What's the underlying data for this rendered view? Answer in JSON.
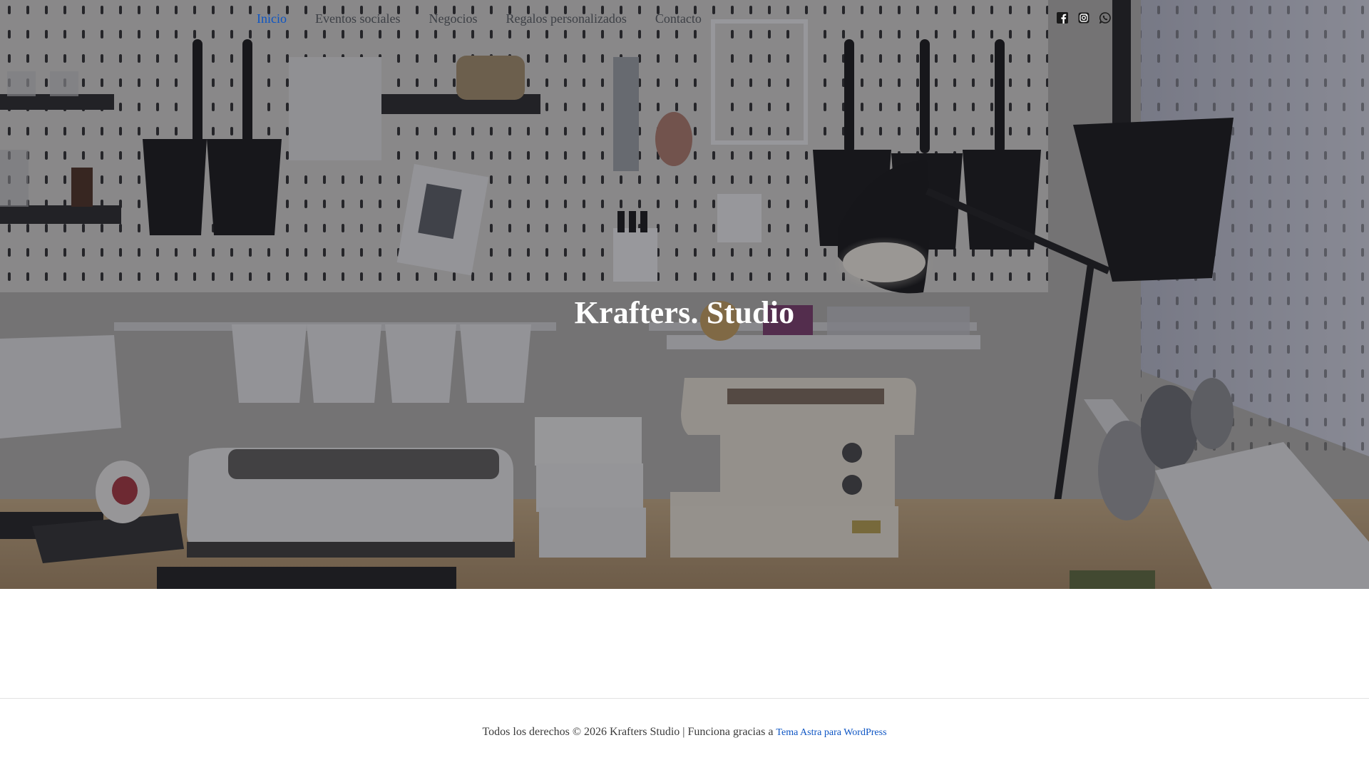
{
  "nav": {
    "items": [
      {
        "label": "Inicio",
        "active": true
      },
      {
        "label": "Eventos sociales",
        "active": false
      },
      {
        "label": "Negocios",
        "active": false
      },
      {
        "label": "Regalos personalizados",
        "active": false
      },
      {
        "label": "Contacto",
        "active": false
      }
    ]
  },
  "social": {
    "icons": [
      "facebook-icon",
      "instagram-icon",
      "whatsapp-icon"
    ]
  },
  "hero": {
    "title": "Krafters. Studio"
  },
  "footer": {
    "text": "Todos los derechos © 2026 Krafters Studio | Funciona gracias a ",
    "link_label": "Tema Astra para WordPress"
  },
  "colors": {
    "accent": "#0d55c4",
    "nav_text": "#3d4046",
    "hero_overlay": "#1c1c26"
  }
}
